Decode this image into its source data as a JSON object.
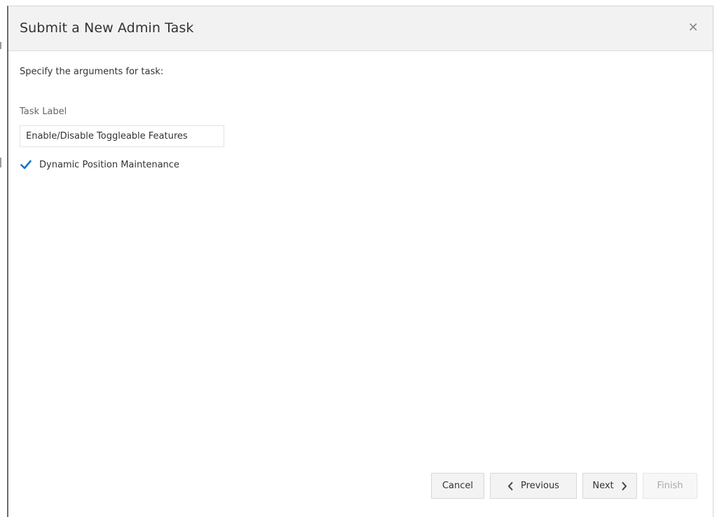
{
  "dialog": {
    "title": "Submit a New Admin Task",
    "close_icon": "close-icon"
  },
  "form": {
    "instructions": "Specify the arguments for task:",
    "task_label": {
      "label": "Task Label",
      "value": "Enable/Disable Toggleable Features"
    },
    "option": {
      "label": "Dynamic Position Maintenance",
      "checked": true
    }
  },
  "footer": {
    "cancel_label": "Cancel",
    "previous_label": "Previous",
    "next_label": "Next",
    "finish_label": "Finish",
    "finish_enabled": false
  },
  "colors": {
    "accent": "#1a73c9",
    "disabled_text": "#a8a8a8"
  }
}
